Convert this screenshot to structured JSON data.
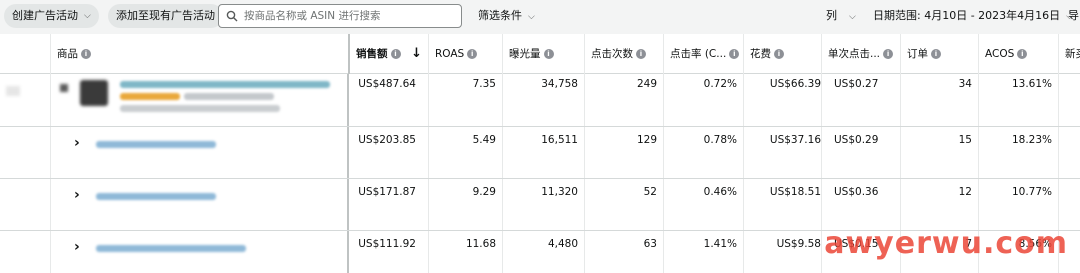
{
  "toolbar": {
    "create_campaign": "创建广告活动",
    "add_to_existing": "添加至现有广告活动",
    "search_placeholder": "按商品名称或 ASIN 进行搜索",
    "filter": "筛选条件",
    "columns": "列",
    "date_range": "日期范围: 4月10日 - 2023年4月16日",
    "export": "导"
  },
  "table": {
    "columns": [
      "商品",
      "销售额",
      "ROAS",
      "曝光量",
      "点击次数",
      "点击率 (C...",
      "花费",
      "单次点击...",
      "订单",
      "ACOS",
      "新买"
    ],
    "rows": [
      {
        "sales": "US$487.64",
        "roas": "7.35",
        "impressions": "34,758",
        "clicks": "249",
        "ctr": "0.72%",
        "spend": "US$66.39",
        "cpc": "US$0.27",
        "orders": "34",
        "acos": "13.61%"
      },
      {
        "sales": "US$203.85",
        "roas": "5.49",
        "impressions": "16,511",
        "clicks": "129",
        "ctr": "0.78%",
        "spend": "US$37.16",
        "cpc": "US$0.29",
        "orders": "15",
        "acos": "18.23%"
      },
      {
        "sales": "US$171.87",
        "roas": "9.29",
        "impressions": "11,320",
        "clicks": "52",
        "ctr": "0.46%",
        "spend": "US$18.51",
        "cpc": "US$0.36",
        "orders": "12",
        "acos": "10.77%"
      },
      {
        "sales": "US$111.92",
        "roas": "11.68",
        "impressions": "4,480",
        "clicks": "63",
        "ctr": "1.41%",
        "spend": "US$9.58",
        "cpc": "US$0.15",
        "orders": "7",
        "acos": "8.56%"
      }
    ]
  },
  "icons": {
    "search": "search-icon",
    "info": "info-icon",
    "sort": "sort-down-icon",
    "expand": "chevron-right-icon",
    "dropdown": "chevron-down-icon"
  },
  "colors": {
    "toolbar_bg": "#f3f4f4",
    "pill_bg": "#e3e6e6",
    "border": "#d5d9d9",
    "watermark": "#eb4637"
  },
  "watermark": "awyerwu.com"
}
